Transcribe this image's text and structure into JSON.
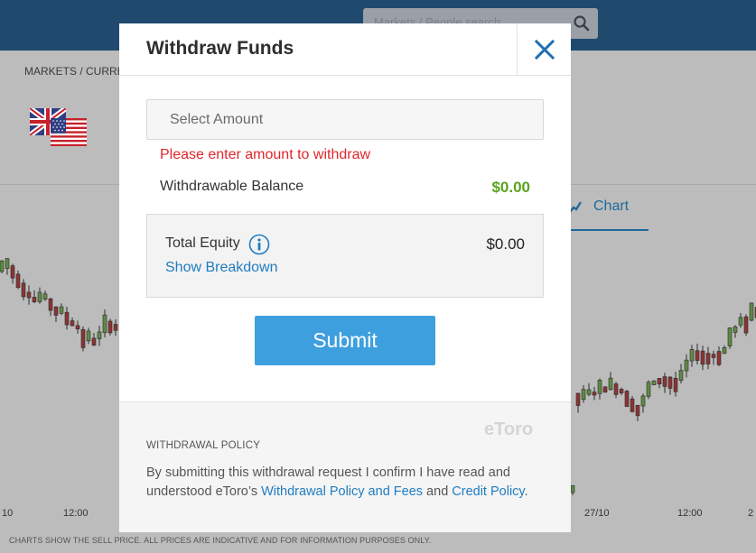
{
  "background": {
    "search_placeholder": "Markets / People search",
    "breadcrumb": "MARKETS  /  CURRE",
    "chart_tab_label": "Chart",
    "x_ticks_left": [
      "10",
      "12:00"
    ],
    "x_ticks_right": [
      "27/10",
      "12:00",
      "2"
    ],
    "disclaimer": "CHARTS SHOW THE SELL PRICE. ALL PRICES ARE INDICATIVE AND FOR INFORMATION PURPOSES ONLY."
  },
  "modal": {
    "title": "Withdraw Funds",
    "amount_placeholder": "Select Amount",
    "error_message": "Please enter amount to withdraw",
    "withdrawable_label": "Withdrawable Balance",
    "withdrawable_value": "$0.00",
    "total_equity_label": "Total Equity",
    "total_equity_value": "$0.00",
    "show_breakdown": "Show Breakdown",
    "submit_label": "Submit",
    "footer": {
      "logo_text": "eToro",
      "policy_heading": "WITHDRAWAL POLICY",
      "policy_text_1": "By submitting this withdrawal request I confirm I have read and understood eToro’s ",
      "policy_link_1": "Withdrawal Policy and Fees",
      "policy_text_2": " and ",
      "policy_link_2": "Credit Policy",
      "policy_text_3": "."
    }
  },
  "colors": {
    "topbar": "#1f4a6e",
    "accent_blue": "#3e9fdf",
    "link_blue": "#1f7cc0",
    "error_red": "#e0262b",
    "balance_green": "#5aa31f"
  }
}
